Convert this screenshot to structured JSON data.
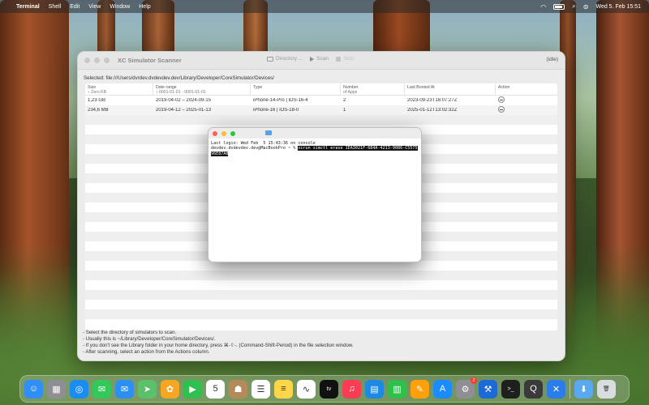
{
  "menubar": {
    "app": "Terminal",
    "items": [
      "Shell",
      "Edit",
      "View",
      "Window",
      "Help"
    ],
    "clock": "Wed 5. Feb  15:51"
  },
  "scanner": {
    "title": "XC Simulator Scanner",
    "toolbar": {
      "directory": "Directory ...",
      "scan": "Scan",
      "stop": "Stop"
    },
    "status": "(idle)",
    "selected": "Selected: file:///Users/dvrdev.dvdevdev.dev/Library/Developer/CoreSimulator/Devices/",
    "columns": {
      "size": "Size",
      "size_sub": "Zero KB",
      "date": "Date range",
      "date_sub": "0001-01-01 - 0001-01-01",
      "type": "Type",
      "apps": "Number",
      "apps_sub": "of Apps",
      "booted": "Last Booted At",
      "action": "Action"
    },
    "rows": [
      {
        "size": "1,23 GB",
        "date": "2019-04-02 – 2024-09-15",
        "type": "iPhone-14-Pro | iOS-16-4",
        "apps": "2",
        "booted": "2023-09-23T16:07:27Z"
      },
      {
        "size": "234,6 MB",
        "date": "2019-04-12 – 2025-01-13",
        "type": "iPhone-16 | iOS-18-0",
        "apps": "1",
        "booted": "2025-01-12T13:02:32Z"
      }
    ],
    "notes": [
      "- Select the directory of simulators to scan.",
      "- Usually this is ~/Library/Developer/CoreSimulator/Devices/.",
      "- If you don't see the Library folder in your home directory, press ⌘-⇧-. (Command-Shift-Period) in the file selection window.",
      "- After scanning, select an action from the Actions column."
    ]
  },
  "terminal": {
    "line1": "Last login: Wed Feb  5 15:43:36 on console",
    "prompt": "devdev.dvdevdev.dev@MacBookPro ~ % ",
    "command": "xcrun simctl erase 1EA3021F-684A-4213-9086-C557596E87A8"
  },
  "dock": {
    "apps": [
      {
        "name": "finder-icon",
        "color": "#2f8ef7",
        "glyph": "☺"
      },
      {
        "name": "launchpad-icon",
        "color": "#8e8e93",
        "glyph": "▦"
      },
      {
        "name": "safari-icon",
        "color": "#1d8cf0",
        "glyph": "◎"
      },
      {
        "name": "messages-icon",
        "color": "#34c759",
        "glyph": "✉"
      },
      {
        "name": "mail-icon",
        "color": "#2e8ff2",
        "glyph": "✉"
      },
      {
        "name": "maps-icon",
        "color": "#5ac06a",
        "glyph": "➤"
      },
      {
        "name": "photos-icon",
        "color": "#f5a623",
        "glyph": "✿"
      },
      {
        "name": "facetime-icon",
        "color": "#30c04f",
        "glyph": "▶"
      },
      {
        "name": "calendar-icon",
        "color": "#ffffff",
        "glyph": "5",
        "dark": true
      },
      {
        "name": "contacts-icon",
        "color": "#b58a5a",
        "glyph": "☗"
      },
      {
        "name": "reminders-icon",
        "color": "#ffffff",
        "glyph": "☰",
        "dark": true
      },
      {
        "name": "notes-icon",
        "color": "#ffd54a",
        "glyph": "≡",
        "dark": true
      },
      {
        "name": "freeform-icon",
        "color": "#ffffff",
        "glyph": "∿",
        "dark": true
      },
      {
        "name": "tv-icon",
        "color": "#111111",
        "glyph": "tv"
      },
      {
        "name": "music-icon",
        "color": "#fa3c55",
        "glyph": "♫"
      },
      {
        "name": "keynote-icon",
        "color": "#1e88e5",
        "glyph": "▤"
      },
      {
        "name": "numbers-icon",
        "color": "#2fbf4a",
        "glyph": "▥"
      },
      {
        "name": "pages-icon",
        "color": "#ff9f0a",
        "glyph": "✎"
      },
      {
        "name": "app-store-icon",
        "color": "#1a8cff",
        "glyph": "A"
      },
      {
        "name": "system-settings-icon",
        "color": "#8e8e93",
        "glyph": "⚙",
        "badge": "2"
      },
      {
        "name": "xcode-icon",
        "color": "#1c6ad6",
        "glyph": "⚒"
      },
      {
        "name": "terminal-icon",
        "color": "#1f1f1f",
        "glyph": ">_"
      },
      {
        "name": "quicktime-icon",
        "color": "#3a3a3c",
        "glyph": "Q"
      },
      {
        "name": "simulator-tools-icon",
        "color": "#2b7de9",
        "glyph": "✕"
      }
    ],
    "trailing": [
      {
        "name": "downloads-folder-icon",
        "color": "#5aa9f0",
        "glyph": "⬇"
      },
      {
        "name": "trash-icon",
        "color": "#d9dde0",
        "glyph": "🗑",
        "dark": true
      }
    ]
  }
}
